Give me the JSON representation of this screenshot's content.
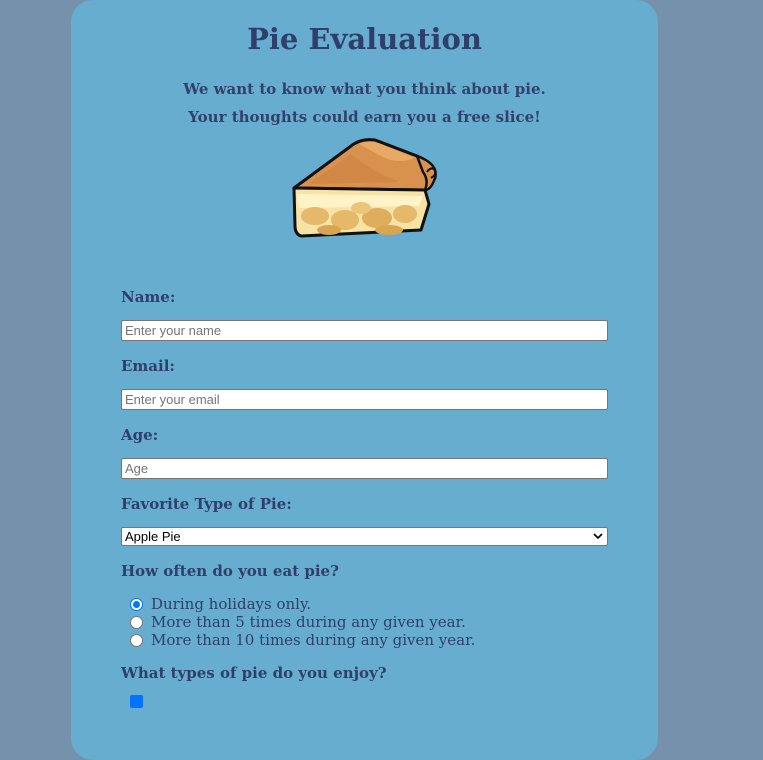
{
  "page": {
    "title": "Pie Evaluation",
    "subtitle_line1": "We want to know what you think about pie.",
    "subtitle_line2": "Your thoughts could earn you a free slice!"
  },
  "image": {
    "icon": "pie-slice-illustration"
  },
  "form": {
    "name": {
      "label": "Name:",
      "placeholder": "Enter your name",
      "value": ""
    },
    "email": {
      "label": "Email:",
      "placeholder": "Enter your email",
      "value": ""
    },
    "age": {
      "label": "Age:",
      "placeholder": "Age",
      "value": ""
    },
    "favorite_pie": {
      "label": "Favorite Type of Pie:",
      "selected": "Apple Pie"
    },
    "frequency": {
      "label": "How often do you eat pie?",
      "options": [
        {
          "label": "During holidays only.",
          "checked": true
        },
        {
          "label": "More than 5 times during any given year.",
          "checked": false
        },
        {
          "label": "More than 10 times during any given year.",
          "checked": false
        }
      ]
    },
    "types": {
      "label": "What types of pie do you enjoy?"
    }
  },
  "colors": {
    "background": "#7691ab",
    "card": "#67adcf",
    "text": "#2f3e6b",
    "accent": "#0075ff"
  }
}
